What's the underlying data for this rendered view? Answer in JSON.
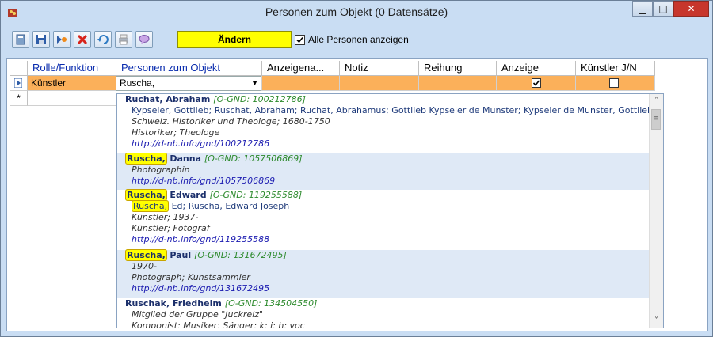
{
  "window": {
    "title": "Personen zum Objekt (0 Datensätze)",
    "minimize_glyph": "▁",
    "maximize_glyph": "□",
    "close_glyph": "✕"
  },
  "toolbar": {
    "aendern_label": "Ändern",
    "show_all_label": "Alle Personen anzeigen",
    "show_all_checked": true,
    "icons": [
      "document-icon",
      "save-icon",
      "add-record-icon",
      "delete-icon",
      "undo-icon",
      "print-icon",
      "comment-icon"
    ]
  },
  "grid": {
    "columns": [
      "Rolle/Funktion",
      "Personen zum Objekt",
      "Anzeigena...",
      "Notiz",
      "Reihung",
      "Anzeige",
      "Künstler J/N"
    ],
    "row1": {
      "rolle": "Künstler",
      "person": "Ruscha,",
      "anzeige_checked": true,
      "kuenstler_checked": false
    },
    "new_row_marker": "*"
  },
  "dropdown": {
    "entries": [
      {
        "highlight": "",
        "name": "Ruchat, Abraham",
        "gnd": "[O-GND: 100212786]",
        "lines": [
          {
            "text": "Kypseler, Gottlieb; Ruschat, Abraham; Ruchat, Abrahamus; Gottlieb Kypseler de Munster; Kypseler de Munster, Gottlieb",
            "style": "plain"
          },
          {
            "text": "Schweiz. Historiker und Theologe; 1680-1750",
            "style": "it"
          },
          {
            "text": "Historiker; Theologe",
            "style": "it"
          },
          {
            "text": "http://d-nb.info/gnd/100212786",
            "style": "link"
          }
        ]
      },
      {
        "highlight": "Ruscha,",
        "name": "Danna",
        "gnd": "[O-GND: 1057506869]",
        "lines": [
          {
            "text": "Photographin",
            "style": "it"
          },
          {
            "text": "http://d-nb.info/gnd/1057506869",
            "style": "link"
          }
        ]
      },
      {
        "highlight": "Ruscha,",
        "name": "Edward",
        "gnd": "[O-GND: 119255588]",
        "lines": [
          {
            "text": "Ed; Ruscha, Edward Joseph",
            "style": "plain",
            "prefix": "Ruscha,"
          },
          {
            "text": "Künstler; 1937-",
            "style": "it"
          },
          {
            "text": "Künstler; Fotograf",
            "style": "it"
          },
          {
            "text": "http://d-nb.info/gnd/119255588",
            "style": "link"
          }
        ]
      },
      {
        "highlight": "Ruscha,",
        "name": "Paul",
        "gnd": "[O-GND: 131672495]",
        "lines": [
          {
            "text": "1970-",
            "style": "it"
          },
          {
            "text": "Photograph; Kunstsammler",
            "style": "it"
          },
          {
            "text": "http://d-nb.info/gnd/131672495",
            "style": "link"
          }
        ]
      },
      {
        "highlight": "",
        "name": "Ruschak, Friedhelm",
        "gnd": "[O-GND: 134504550]",
        "lines": [
          {
            "text": "Mitglied der Gruppe \"Juckreiz\"",
            "style": "it"
          },
          {
            "text": "Komponist; Musiker; Sänger; k; i; h; voc",
            "style": "it"
          }
        ]
      }
    ],
    "scroll_up_glyph": "˄",
    "scroll_down_glyph": "˅",
    "scroll_thumb_glyph": "≡"
  },
  "colors": {
    "window_bg": "#c9ddf3",
    "selected_row": "#fbb05a",
    "highlight": "#ffff00",
    "gnd_green": "#2d8a2d",
    "link_blue": "#1a1ab0",
    "close_red": "#c7362c"
  }
}
